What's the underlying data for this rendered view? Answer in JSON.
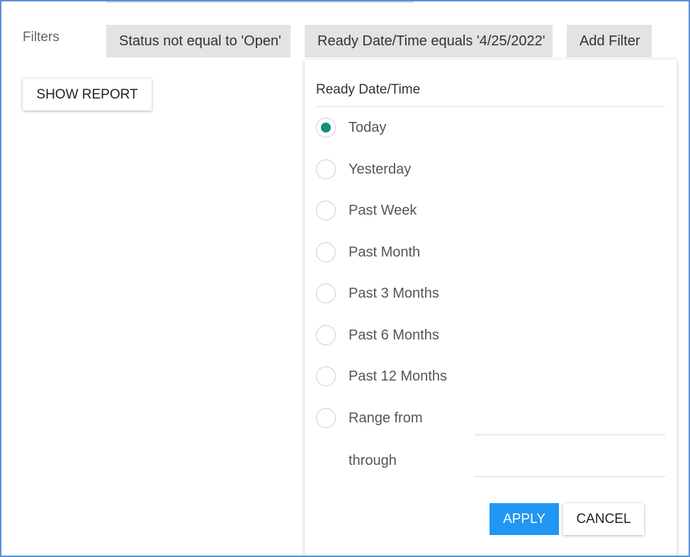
{
  "filters": {
    "label": "Filters",
    "chips": [
      {
        "label": "Status not equal to 'Open'"
      },
      {
        "label": "Ready Date/Time equals '4/25/2022'"
      }
    ],
    "add_filter_label": "Add Filter"
  },
  "show_report_label": "SHOW REPORT",
  "panel": {
    "title": "Ready Date/Time",
    "selected": "Today",
    "options": [
      {
        "label": "Today",
        "checked": true
      },
      {
        "label": "Yesterday",
        "checked": false
      },
      {
        "label": "Past Week",
        "checked": false
      },
      {
        "label": "Past Month",
        "checked": false
      },
      {
        "label": "Past 3 Months",
        "checked": false
      },
      {
        "label": "Past 6 Months",
        "checked": false
      },
      {
        "label": "Past 12 Months",
        "checked": false
      },
      {
        "label": "Range from",
        "checked": false
      }
    ],
    "through_label": "through",
    "range_from_value": "",
    "range_through_value": "",
    "apply_label": "APPLY",
    "cancel_label": "CANCEL"
  },
  "colors": {
    "accent_radio": "#0f8f7e",
    "apply_button": "#2196f3",
    "frame_border": "#5b8fd6",
    "chip_background": "#e3e3e3"
  }
}
